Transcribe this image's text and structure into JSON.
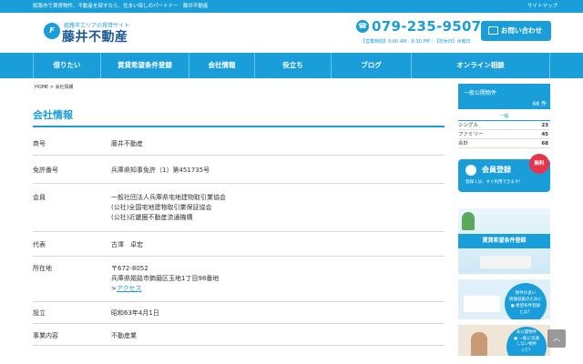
{
  "topbar": {
    "tagline": "姫路市で賃貸物件、不動産を探すなら、住まい探しのパートナー　藤井不動産",
    "sitemap": "サイトマップ"
  },
  "header": {
    "logo_mark": "F",
    "logo_sub": "姫路市エリアの賃貸サイト",
    "logo_name": "藤井不動産",
    "phone_icon": "☎",
    "phone": "079-235-9507",
    "hours": "【営業時間】9:00 AM - 6:30 PM｜【定休日】水曜日",
    "contact_label": "お問い合わせ"
  },
  "nav": [
    {
      "label": "借りたい"
    },
    {
      "label": "賃貸希望条件登録"
    },
    {
      "label": "会社情報"
    },
    {
      "label": "役立ち"
    },
    {
      "label": "ブログ"
    },
    {
      "label": "オンライン相談"
    }
  ],
  "breadcrumb": "HOME > 会社情報",
  "main": {
    "title": "会社情報",
    "rows": {
      "r0": {
        "k": "商号",
        "v": "藤井不動産"
      },
      "r1": {
        "k": "免許番号",
        "v": "兵庫県知事免許（1）第451735号"
      },
      "r2": {
        "k": "会員",
        "v1": "一般社団法人兵庫県宅地建物取引業協会",
        "v2": "(公社)全国宅地建物取引業保証協会",
        "v3": "(公社)近畿圏不動産流通機構"
      },
      "r3": {
        "k": "代表",
        "v": "古澤　卓宏"
      },
      "r4": {
        "k": "所在地",
        "v1": "〒672-8052",
        "v2": "兵庫県姫路市飾磨区玉地1丁目98番地",
        "v3_prefix": ">",
        "v3_link": "アクセス"
      },
      "r5": {
        "k": "設立",
        "v": "昭和63年4月1日"
      },
      "r6": {
        "k": "事業内容",
        "v": "不動産業"
      }
    }
  },
  "sidebar": {
    "count_title": "一般公開物件",
    "count_total": "68 件",
    "general_label": "一般",
    "stats": {
      "s0": {
        "label": "シングル",
        "n": "23"
      },
      "s1": {
        "label": "ファミリー",
        "n": "45"
      },
      "s2": {
        "label": "合計",
        "n": "68"
      }
    },
    "member": {
      "title": "会員登録",
      "sub": "登録１分、すぐ利用できます！",
      "badge": "無料"
    },
    "banner1": "賃貸希望条件登録",
    "banner2": {
      "l1": "物件の良い",
      "l2": "情報収集のために",
      "l3": "● 希望条件登録",
      "l4": "とは？"
    },
    "banner3": {
      "l1": "未公開物件",
      "l2": "● 一般に流通",
      "l3": "しない物件",
      "l4": "って？"
    }
  },
  "scroll_top_icon": "︿",
  "colors": {
    "accent": "#1a9ed9",
    "badge": "#e8334a"
  }
}
